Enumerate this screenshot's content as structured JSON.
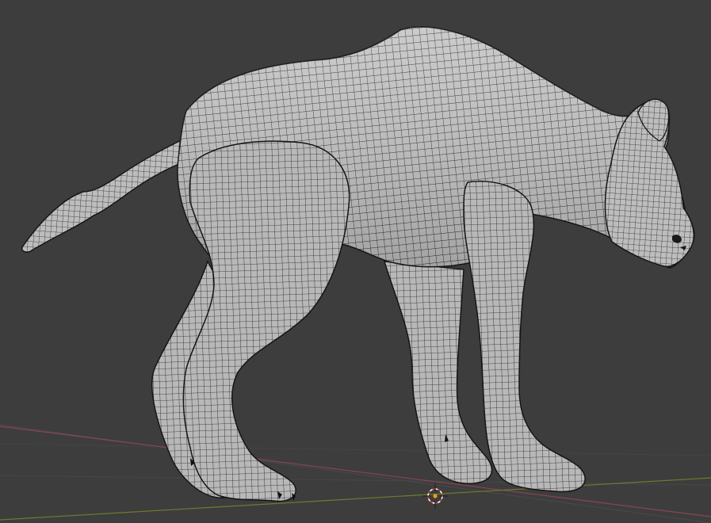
{
  "viewport": {
    "editor": "3D Viewport",
    "shading": "solid-wireframe",
    "background_color": "#3d3d3d",
    "mesh_color": "#c6c6c6",
    "wire_color": "#1a1a1a",
    "object_name": "",
    "x_axis_color": "#a04a55",
    "y_axis_color": "#6f8a2e",
    "origin_color": "#e8a020"
  },
  "scene": {
    "object_description_icon": "animal-mesh-icon",
    "has_floor_grid": true,
    "has_3d_cursor": true
  }
}
